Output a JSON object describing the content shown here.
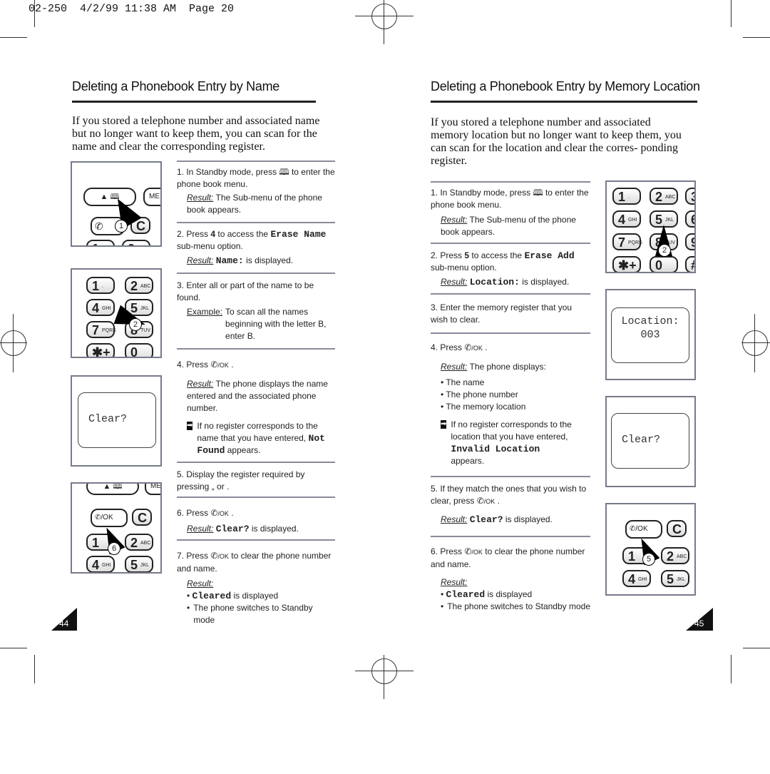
{
  "header": "02-250  4/2/99 11:38 AM  Page 20",
  "left": {
    "title": "Deleting a Phonebook Entry by Name",
    "intro": "If you stored a telephone number and associated name but no longer want to keep them, you can scan for the name and clear the corresponding register.",
    "page_number": "44",
    "s1": {
      "a": "1. In Standby mode, press",
      "b": "to enter the phone book menu.",
      "result_label": "Result:",
      "result": "The Sub-menu of the phone book appears."
    },
    "s2": {
      "a": "2. Press",
      "key": "4",
      "b": "to access the",
      "option": "Erase Name",
      "c": "sub-menu option.",
      "result_label": "Result:",
      "result_mono": "Name:",
      "result": "is displayed."
    },
    "s3": {
      "a": "3. Enter all or part of the name to be found.",
      "example_label": "Example:",
      "example": "To scan all the names beginning with the letter B, enter B."
    },
    "s4": {
      "a": "4. Press",
      "ok": "/OK",
      "b": ".",
      "result_label": "Result:",
      "result": "The phone displays the name entered and the associated phone number.",
      "note_a": "If no register corresponds to the name that you have entered,",
      "note_mono": "Not Found",
      "note_b": "appears."
    },
    "s5": {
      "a": "5. Display the register required by pressing",
      "b": "„  or    ."
    },
    "s6": {
      "a": "6. Press",
      "ok": "/OK",
      "b": ".",
      "result_label": "Result:",
      "result_mono": "Clear?",
      "result": "is displayed."
    },
    "s7": {
      "a": "7. Press",
      "ok": "/OK",
      "b": "to clear the phone number and name.",
      "result_label": "Result:",
      "bullet1_mono": "Cleared",
      "bullet1": "is displayed",
      "bullet2": "The phone switches to Standby mode"
    },
    "lcd_text": "Clear?",
    "callouts": [
      "1",
      "2",
      "6"
    ]
  },
  "right": {
    "title": "Deleting a Phonebook Entry by Memory Location",
    "intro": "If you stored a telephone number and associated memory location but no longer want to keep them, you can scan for the location and clear the corres- ponding register.",
    "page_number": "45",
    "s1": {
      "a": "1. In Standby mode, press",
      "b": "to enter the phone book menu.",
      "result_label": "Result:",
      "result": "The Sub-menu of the phone book appears."
    },
    "s2": {
      "a": "2. Press",
      "key": "5",
      "b": "to access the",
      "option": "Erase Add",
      "c": "sub-menu option.",
      "result_label": "Result:",
      "result_mono": "Location:",
      "result": "is displayed."
    },
    "s3": {
      "a": "3. Enter the memory register that you wish to clear."
    },
    "s4": {
      "a": "4. Press",
      "ok": "/OK",
      "b": ".",
      "result_label": "Result:",
      "result": "The phone displays:",
      "bullets": [
        "The name",
        "The phone number",
        "The memory location"
      ],
      "note_a": "If no register corresponds to the location that you have entered,",
      "note_mono": "Invalid Location",
      "note_b": "appears."
    },
    "s5": {
      "a": "5. If they match the ones that you wish to clear, press",
      "ok": "/OK",
      "b": ".",
      "result_label": "Result:",
      "result_mono": "Clear?",
      "result": "is displayed."
    },
    "s6": {
      "a": "6. Press",
      "ok": "/OK",
      "b": "to clear the phone number and name.",
      "result_label": "Result:",
      "bullet1_mono": "Cleared",
      "bullet1": "is displayed",
      "bullet2": "The phone switches to Standby mode"
    },
    "lcd_location_label": "Location:",
    "lcd_location_value": "003",
    "lcd_clear": "Clear?",
    "callouts": [
      "2",
      "5"
    ]
  },
  "keys": {
    "k1": "1",
    "k2": "2",
    "k2s": "ABC",
    "k3": "3",
    "k4": "4",
    "k4s": "GHI",
    "k5": "5",
    "k5s": "JKL",
    "k6": "6",
    "k7": "7",
    "k7s": "PQRS",
    "k8": "8",
    "k8s": "TUV",
    "k9": "9",
    "kstar": "✱+",
    "k0": "0",
    "khash": "#",
    "kc": "C",
    "kme": "ME",
    "kok": "/OK"
  }
}
